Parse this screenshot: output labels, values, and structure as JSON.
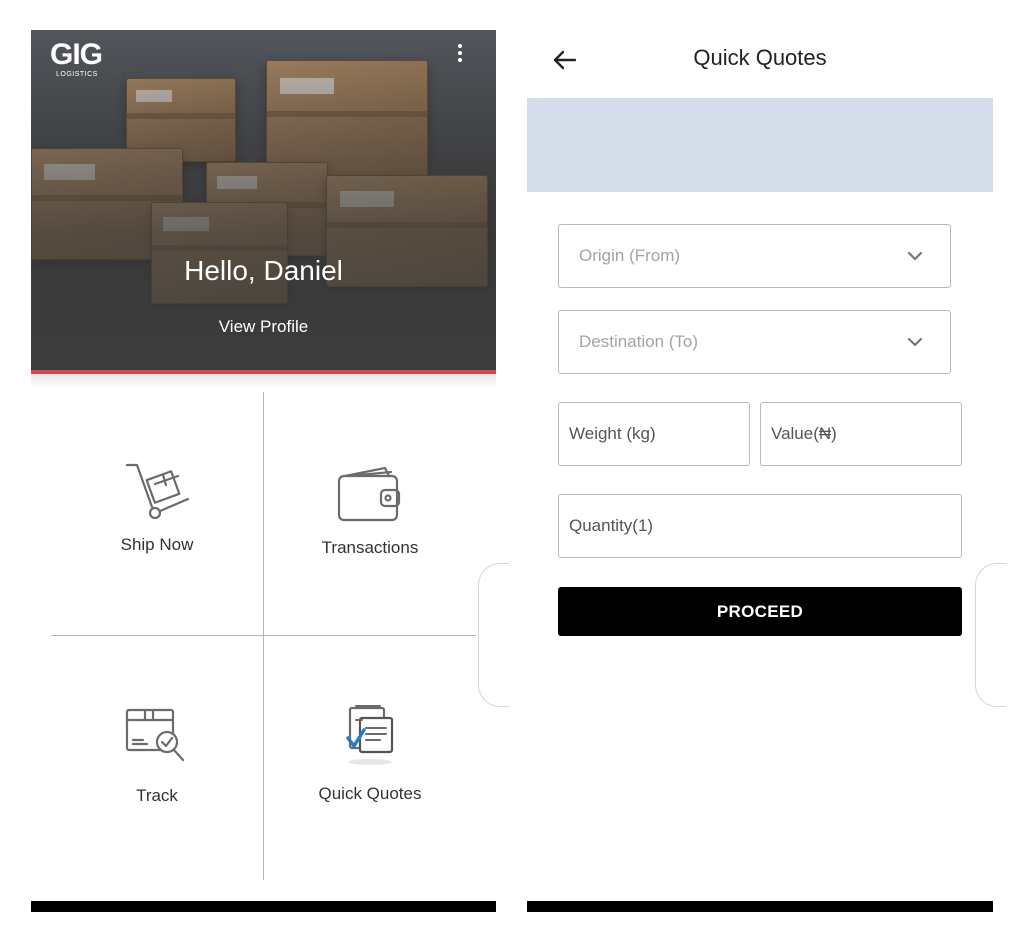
{
  "home": {
    "logo": {
      "text": "GIG",
      "subtext": "LOGISTICS"
    },
    "greeting": "Hello, Daniel",
    "view_profile": "View Profile",
    "tiles": [
      {
        "label": "Ship Now",
        "icon": "trolley-icon"
      },
      {
        "label": "Transactions",
        "icon": "wallet-icon"
      },
      {
        "label": "Track",
        "icon": "track-package-icon"
      },
      {
        "label": "Quick Quotes",
        "icon": "quote-document-icon"
      }
    ]
  },
  "quotes": {
    "title": "Quick Quotes",
    "origin_placeholder": "Origin (From)",
    "destination_placeholder": "Destination (To)",
    "weight_placeholder": "Weight (kg)",
    "value_placeholder": "Value(₦)",
    "quantity_placeholder": "Quantity(1)",
    "proceed_label": "PROCEED"
  },
  "colors": {
    "accent_red": "#d6484e",
    "banner": "#d5dcea",
    "button": "#000000",
    "icon_blue": "#1f7fc9"
  }
}
